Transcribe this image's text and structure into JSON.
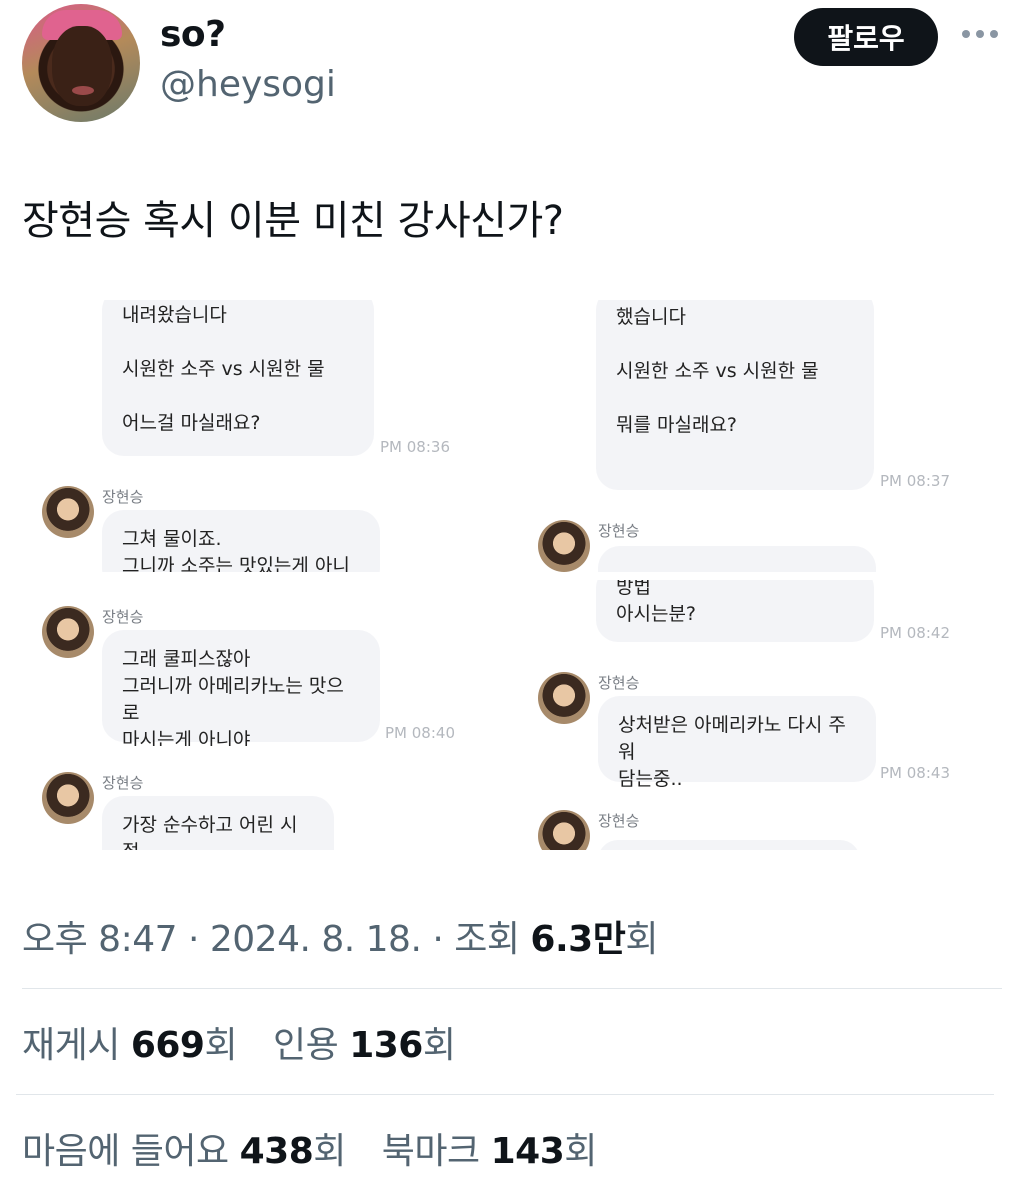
{
  "header": {
    "display_name": "so?",
    "handle": "@heysogi",
    "follow_label": "팔로우"
  },
  "tweet": {
    "text": "장현승 혹시 이분 미친 강사신가?"
  },
  "media": {
    "left": {
      "clip1": {
        "lines": [
          "내려왔습니다",
          "",
          "시원한 소주 vs 시원한 물",
          "",
          "어느걸 마실래요?"
        ],
        "time": "PM 08:36"
      },
      "clip2": {
        "sender": "장현승",
        "lines": [
          "그쳐 물이죠.",
          "그니까 소주는 맛있는게 아니에"
        ]
      },
      "clip3": {
        "sender": "장현승",
        "lines": [
          "그래 쿨피스잖아",
          "그러니까 아메리카노는 맛으로",
          "마시는게 아니야"
        ],
        "time": "PM 08:40"
      },
      "clip4": {
        "sender": "장현승",
        "lines": [
          "가장 순수하고 어린 시절"
        ]
      }
    },
    "right": {
      "clip1": {
        "lines": [
          "했습니다",
          "",
          "시원한 소주 vs 시원한 물",
          "",
          "뭐를 마실래요?"
        ],
        "time": "PM 08:37"
      },
      "clip2": {
        "sender": "장현승"
      },
      "clip3": {
        "lines": [
          "방법",
          "아시는분?"
        ],
        "time": "PM 08:42"
      },
      "clip4": {
        "sender": "장현승",
        "lines": [
          "상처받은 아메리카노 다시 주워",
          "담는중.."
        ],
        "time": "PM 08:43"
      },
      "clip5": {
        "sender": "장현승"
      }
    }
  },
  "meta": {
    "time": "오후 8:47 · 2024. 8. 18. · 조회 ",
    "views": "6.3만",
    "views_unit": "회"
  },
  "stats": {
    "retweets_label": "재게시 ",
    "retweets": "669",
    "retweets_unit": "회",
    "quotes_label": "인용 ",
    "quotes": "136",
    "quotes_unit": "회",
    "likes_label": "마음에 들어요 ",
    "likes": "438",
    "likes_unit": "회",
    "bookmarks_label": "북마크 ",
    "bookmarks": "143",
    "bookmarks_unit": "회"
  }
}
